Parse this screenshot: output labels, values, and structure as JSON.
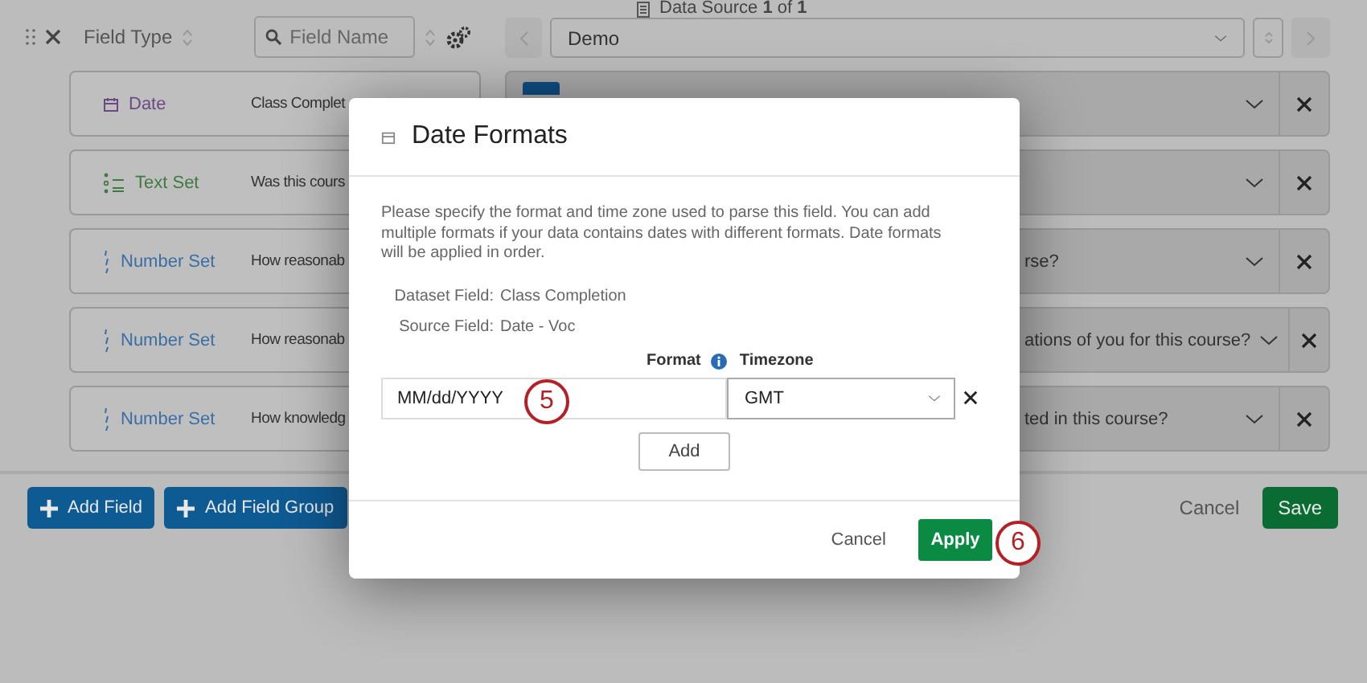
{
  "toolbar": {
    "column_header": "Field Type",
    "search": {
      "placeholder": "Field Name"
    },
    "data_source": "Data Source **1** of **1**",
    "source_select": {
      "value": "Demo"
    }
  },
  "fields": [
    {
      "kind": "date",
      "type_label": "Date",
      "question": "Class Complet",
      "source_badge": true
    },
    {
      "kind": "text_set",
      "type_label": "Text Set",
      "question": "Was this cours"
    },
    {
      "kind": "number_set",
      "type_label": "Number Set",
      "question": "How reasonab",
      "source_text": "rse?"
    },
    {
      "kind": "number_set",
      "type_label": "Number Set",
      "question": "How reasonab",
      "source_text": "ations of you for this course?"
    },
    {
      "kind": "number_set",
      "type_label": "Number Set",
      "question": "How knowledg",
      "source_text": "ted in this course?"
    }
  ],
  "add_buttons": [
    "Add Field",
    "Add Field Group"
  ],
  "footer": {
    "cancel": "Cancel",
    "save": "Save"
  },
  "dialog": {
    "title": "Date Formats",
    "description": "Please specify the format and time zone used to parse this field. You can add multiple formats if your data contains dates with different formats. Date formats will be applied in order.",
    "details": [
      {
        "label": "Dataset Field:",
        "value": "Class Completion"
      },
      {
        "label": "Source Field:",
        "value": "Date - Voc"
      }
    ],
    "format_label": "Format",
    "timezone_label": "Timezone",
    "formats": [
      {
        "value": "MM/dd/YYYY",
        "timezone": "GMT",
        "callout": "5"
      }
    ],
    "add_button": "Add",
    "cancel": "Cancel",
    "apply": "Apply",
    "apply_callout": "6"
  }
}
